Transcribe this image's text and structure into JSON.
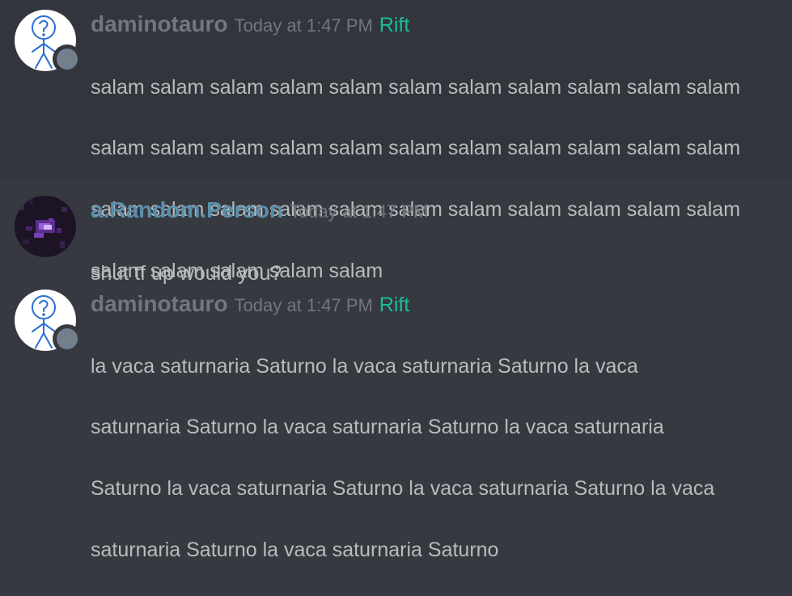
{
  "messages": [
    {
      "username": "daminotauro",
      "timestamp": "Today at 1:47 PM",
      "role": "Rift",
      "lines": [
        "salam salam salam salam salam salam salam salam salam salam salam",
        "salam salam salam salam salam salam salam salam salam salam salam",
        "salam salam salam salam salam salam salam salam salam salam salam",
        "salam salam salam salam salam"
      ]
    },
    {
      "username": "a.Random.Person",
      "timestamp": "Today at 1:47 PM",
      "lines": [
        "shut tf up would you?"
      ]
    },
    {
      "username": "daminotauro",
      "timestamp": "Today at 1:47 PM",
      "role": "Rift",
      "lines": [
        "la vaca saturnaria Saturno la vaca saturnaria Saturno la vaca",
        "saturnaria Saturno la vaca saturnaria Saturno la vaca saturnaria",
        "Saturno la vaca saturnaria Saturno la vaca saturnaria Saturno la vaca",
        "saturnaria Saturno la vaca saturnaria Saturno"
      ]
    }
  ],
  "colors": {
    "background": "#36393f",
    "highlight_background": "#32353b",
    "username_default": "#72767d",
    "username_blue": "#5a8fab",
    "role_color": "#1abc9c",
    "text": "#b9bbbe",
    "status_offline": "#747f8d"
  },
  "icons": {
    "avatar_1": "stick-figure-avatar-icon",
    "avatar_2": "pixel-art-avatar-icon",
    "status": "offline-status-icon"
  }
}
